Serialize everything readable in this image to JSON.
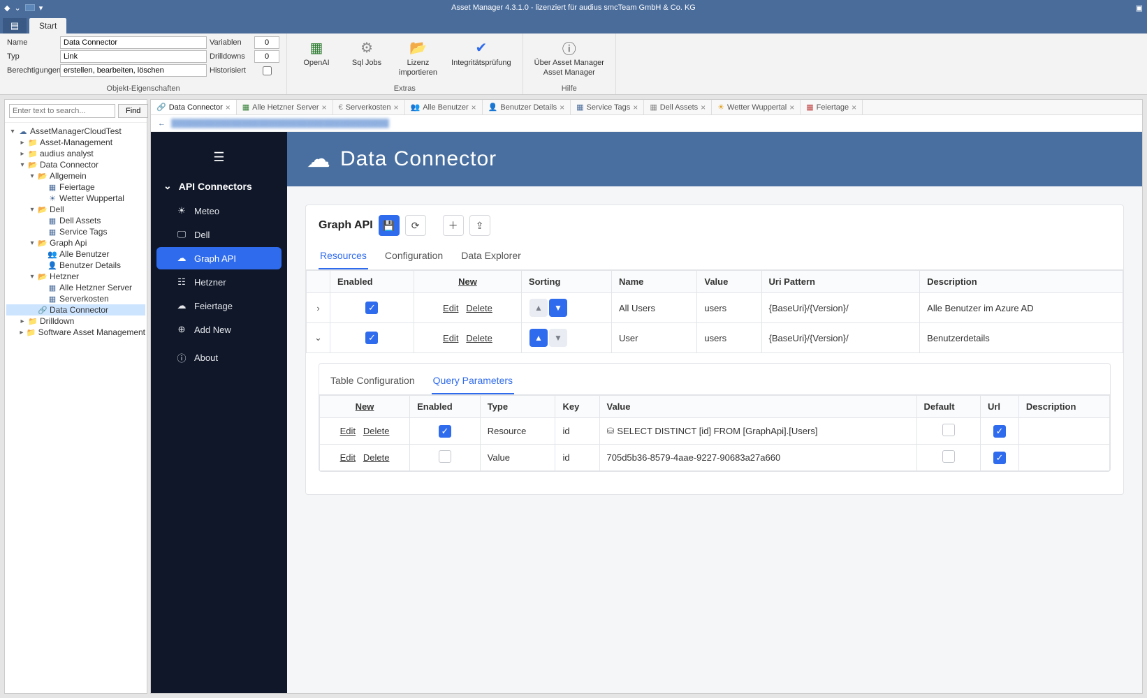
{
  "titlebar": {
    "title": "Asset Manager 4.3.1.0 - lizenziert für audius smcTeam GmbH & Co. KG"
  },
  "ribbon": {
    "file_glyph": "▤",
    "tab_start": "Start",
    "labels": {
      "name": "Name",
      "typ": "Typ",
      "berechtigungen": "Berechtigungen",
      "variablen": "Variablen",
      "drilldowns": "Drilldowns",
      "historisiert": "Historisiert"
    },
    "values": {
      "name": "Data Connector",
      "typ": "Link",
      "berechtigungen": "erstellen, bearbeiten, löschen",
      "variablen": "0",
      "drilldowns": "0"
    },
    "group_object": "Objekt-Eigenschaften",
    "extras": {
      "openai": "OpenAI",
      "sqljobs": "Sql Jobs",
      "lizenz1": "Lizenz",
      "lizenz2": "importieren",
      "integritaet": "Integritätsprüfung",
      "group": "Extras"
    },
    "hilfe": {
      "ueber1": "Über Asset Manager",
      "ueber2": "Asset Manager",
      "group": "Hilfe"
    }
  },
  "search": {
    "placeholder": "Enter text to search...",
    "find": "Find"
  },
  "tree": {
    "root": "AssetManagerCloudTest",
    "asset_mgmt": "Asset-Management",
    "audius": "audius analyst",
    "data_connector": "Data Connector",
    "allgemein": "Allgemein",
    "feiertage": "Feiertage",
    "wetter": "Wetter Wuppertal",
    "dell": "Dell",
    "dell_assets": "Dell Assets",
    "service_tags": "Service Tags",
    "graph_api": "Graph Api",
    "alle_benutzer": "Alle Benutzer",
    "benutzer_details": "Benutzer Details",
    "hetzner": "Hetzner",
    "alle_hetzner": "Alle Hetzner Server",
    "serverkosten": "Serverkosten",
    "dc_leaf": "Data Connector",
    "drilldown": "Drilldown",
    "sam": "Software Asset Management"
  },
  "tabs": {
    "data_connector": "Data Connector",
    "alle_hetzner": "Alle Hetzner Server",
    "serverkosten": "Serverkosten",
    "alle_benutzer": "Alle Benutzer",
    "benutzer_details": "Benutzer Details",
    "service_tags": "Service Tags",
    "dell_assets": "Dell Assets",
    "wetter": "Wetter Wuppertal",
    "feiertage": "Feiertage"
  },
  "dc": {
    "sidebar": {
      "section": "API Connectors",
      "meteo": "Meteo",
      "dell": "Dell",
      "graph": "Graph API",
      "hetzner": "Hetzner",
      "feiertage": "Feiertage",
      "add": "Add New",
      "about": "About"
    },
    "header_title": "Data Connector",
    "card_title": "Graph API",
    "tabs": {
      "resources": "Resources",
      "configuration": "Configuration",
      "explorer": "Data Explorer"
    },
    "res_head": {
      "enabled": "Enabled",
      "new": "New",
      "sorting": "Sorting",
      "name": "Name",
      "value": "Value",
      "uri": "Uri Pattern",
      "desc": "Description",
      "edit": "Edit",
      "delete": "Delete"
    },
    "res_rows": [
      {
        "name": "All Users",
        "value": "users",
        "uri": "{BaseUri}/{Version}/",
        "desc": "Alle Benutzer im Azure AD"
      },
      {
        "name": "User",
        "value": "users",
        "uri": "{BaseUri}/{Version}/",
        "desc": "Benutzerdetails"
      }
    ],
    "sub_tabs": {
      "tableconf": "Table Configuration",
      "queryparams": "Query Parameters"
    },
    "qp_head": {
      "new": "New",
      "enabled": "Enabled",
      "type": "Type",
      "key": "Key",
      "value": "Value",
      "default": "Default",
      "url": "Url",
      "desc": "Description",
      "edit": "Edit",
      "delete": "Delete"
    },
    "qp_rows": [
      {
        "type": "Resource",
        "key": "id",
        "value": "SELECT DISTINCT [id] FROM [GraphApi].[Users]",
        "enabled": true,
        "default": false,
        "url": true,
        "dbicon": true
      },
      {
        "type": "Value",
        "key": "id",
        "value": "705d5b36-8579-4aae-9227-90683a27a660",
        "enabled": false,
        "default": false,
        "url": true,
        "dbicon": false
      }
    ]
  }
}
